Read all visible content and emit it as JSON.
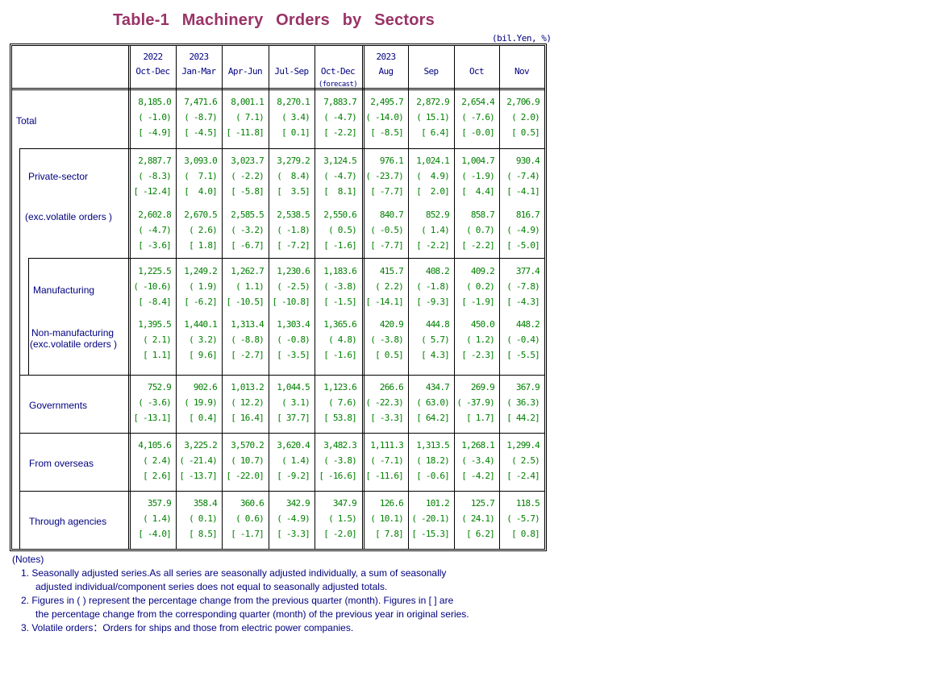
{
  "title": "Table-1  Machinery  Orders  by  Sectors",
  "unit": "(bil.Yen, %)",
  "columns": [
    {
      "year": "2022",
      "period": "Oct-Dec",
      "note": ""
    },
    {
      "year": "2023",
      "period": "Jan-Mar",
      "note": ""
    },
    {
      "year": "",
      "period": "Apr-Jun",
      "note": ""
    },
    {
      "year": "",
      "period": "Jul-Sep",
      "note": ""
    },
    {
      "year": "",
      "period": "Oct-Dec",
      "note": "(forecast)"
    },
    {
      "year": "2023",
      "period": "Aug",
      "note": ""
    },
    {
      "year": "",
      "period": "Sep",
      "note": ""
    },
    {
      "year": "",
      "period": "Oct",
      "note": ""
    },
    {
      "year": "",
      "period": "Nov",
      "note": ""
    }
  ],
  "rows": [
    {
      "label": "Total",
      "label2": "",
      "values": [
        "8,185.0",
        "7,471.6",
        "8,001.1",
        "8,270.1",
        "7,883.7",
        "2,495.7",
        "2,872.9",
        "2,654.4",
        "2,706.9"
      ],
      "qoq": [
        "( -1.0)",
        "( -8.7)",
        "( 7.1)",
        "( 3.4)",
        "( -4.7)",
        "( -14.0)",
        "( 15.1)",
        "( -7.6)",
        "( 2.0)"
      ],
      "yoy": [
        "[ -4.9]",
        "[ -4.5]",
        "[ -11.8]",
        "[ 0.1]",
        "[ -2.2]",
        "[ -8.5]",
        "[ 6.4]",
        "[ -0.0]",
        "[ 0.5]"
      ]
    },
    {
      "label": "Private-sector",
      "label2": "",
      "values": [
        "2,887.7",
        "3,093.0",
        "3,023.7",
        "3,279.2",
        "3,124.5",
        "976.1",
        "1,024.1",
        "1,004.7",
        "930.4"
      ],
      "qoq": [
        "( -8.3)",
        "(  7.1)",
        "( -2.2)",
        "(  8.4)",
        "( -4.7)",
        "( -23.7)",
        "(  4.9)",
        "( -1.9)",
        "( -7.4)"
      ],
      "yoy": [
        "[ -12.4]",
        "[  4.0]",
        "[ -5.8]",
        "[  3.5]",
        "[  8.1]",
        "[ -7.7]",
        "[  2.0]",
        "[  4.4]",
        "[ -4.1]"
      ]
    },
    {
      "label": "(exc.volatile orders )",
      "label2": "",
      "values": [
        "2,602.8",
        "2,670.5",
        "2,585.5",
        "2,538.5",
        "2,550.6",
        "840.7",
        "852.9",
        "858.7",
        "816.7"
      ],
      "qoq": [
        "( -4.7)",
        "( 2.6)",
        "( -3.2)",
        "( -1.8)",
        "( 0.5)",
        "( -0.5)",
        "( 1.4)",
        "( 0.7)",
        "( -4.9)"
      ],
      "yoy": [
        "[ -3.6]",
        "[ 1.8]",
        "[ -6.7]",
        "[ -7.2]",
        "[ -1.6]",
        "[ -7.7]",
        "[ -2.2]",
        "[ -2.2]",
        "[ -5.0]"
      ]
    },
    {
      "label": "Manufacturing",
      "label2": "",
      "values": [
        "1,225.5",
        "1,249.2",
        "1,262.7",
        "1,230.6",
        "1,183.6",
        "415.7",
        "408.2",
        "409.2",
        "377.4"
      ],
      "qoq": [
        "( -10.6)",
        "( 1.9)",
        "( 1.1)",
        "( -2.5)",
        "( -3.8)",
        "( 2.2)",
        "( -1.8)",
        "( 0.2)",
        "( -7.8)"
      ],
      "yoy": [
        "[ -8.4]",
        "[ -6.2]",
        "[ -10.5]",
        "[ -10.8]",
        "[ -1.5]",
        "[ -14.1]",
        "[ -9.3]",
        "[ -1.9]",
        "[ -4.3]"
      ]
    },
    {
      "label": "Non-manufacturing",
      "label2": "(exc.volatile orders )",
      "values": [
        "1,395.5",
        "1,440.1",
        "1,313.4",
        "1,303.4",
        "1,365.6",
        "420.9",
        "444.8",
        "450.0",
        "448.2"
      ],
      "qoq": [
        "( 2.1)",
        "( 3.2)",
        "( -8.8)",
        "( -0.8)",
        "( 4.8)",
        "( -3.8)",
        "( 5.7)",
        "( 1.2)",
        "( -0.4)"
      ],
      "yoy": [
        "[ 1.1]",
        "[ 9.6]",
        "[ -2.7]",
        "[ -3.5]",
        "[ -1.6]",
        "[ 0.5]",
        "[ 4.3]",
        "[ -2.3]",
        "[ -5.5]"
      ]
    },
    {
      "label": "Governments",
      "label2": "",
      "values": [
        "752.9",
        "902.6",
        "1,013.2",
        "1,044.5",
        "1,123.6",
        "266.6",
        "434.7",
        "269.9",
        "367.9"
      ],
      "qoq": [
        "( -3.6)",
        "( 19.9)",
        "( 12.2)",
        "( 3.1)",
        "( 7.6)",
        "( -22.3)",
        "( 63.0)",
        "( -37.9)",
        "( 36.3)"
      ],
      "yoy": [
        "[ -13.1]",
        "[ 0.4]",
        "[ 16.4]",
        "[ 37.7]",
        "[ 53.8]",
        "[ -3.3]",
        "[ 64.2]",
        "[ 1.7]",
        "[ 44.2]"
      ]
    },
    {
      "label": "From overseas",
      "label2": "",
      "values": [
        "4,105.6",
        "3,225.2",
        "3,570.2",
        "3,620.4",
        "3,482.3",
        "1,111.3",
        "1,313.5",
        "1,268.1",
        "1,299.4"
      ],
      "qoq": [
        "( 2.4)",
        "( -21.4)",
        "( 10.7)",
        "( 1.4)",
        "( -3.8)",
        "( -7.1)",
        "( 18.2)",
        "( -3.4)",
        "( 2.5)"
      ],
      "yoy": [
        "[ 2.6]",
        "[ -13.7]",
        "[ -22.0]",
        "[ -9.2]",
        "[ -16.6]",
        "[ -11.6]",
        "[ -0.6]",
        "[ -4.2]",
        "[ -2.4]"
      ]
    },
    {
      "label": "Through agencies",
      "label2": "",
      "values": [
        "357.9",
        "358.4",
        "360.6",
        "342.9",
        "347.9",
        "126.6",
        "101.2",
        "125.7",
        "118.5"
      ],
      "qoq": [
        "( 1.4)",
        "( 0.1)",
        "( 0.6)",
        "( -4.9)",
        "( 1.5)",
        "( 10.1)",
        "( -20.1)",
        "( 24.1)",
        "( -5.7)"
      ],
      "yoy": [
        "[ -4.0]",
        "[ 8.5]",
        "[ -1.7]",
        "[ -3.3]",
        "[ -2.0]",
        "[ 7.8]",
        "[ -15.3]",
        "[ 6.2]",
        "[ 0.8]"
      ]
    }
  ],
  "notes": {
    "heading": "(Notes)",
    "items": [
      "1. Seasonally adjusted series.As all series are seasonally adjusted individually, a sum of seasonally",
      "adjusted individual/component series does not equal to seasonally adjusted totals.",
      "2. Figures in ( ) represent the percentage change from the previous quarter (month). Figures in [ ] are",
      "the percentage change from the corresponding quarter (month) of the previous year in original series.",
      "3. Volatile orders：Orders for ships and those from electric power companies."
    ]
  }
}
